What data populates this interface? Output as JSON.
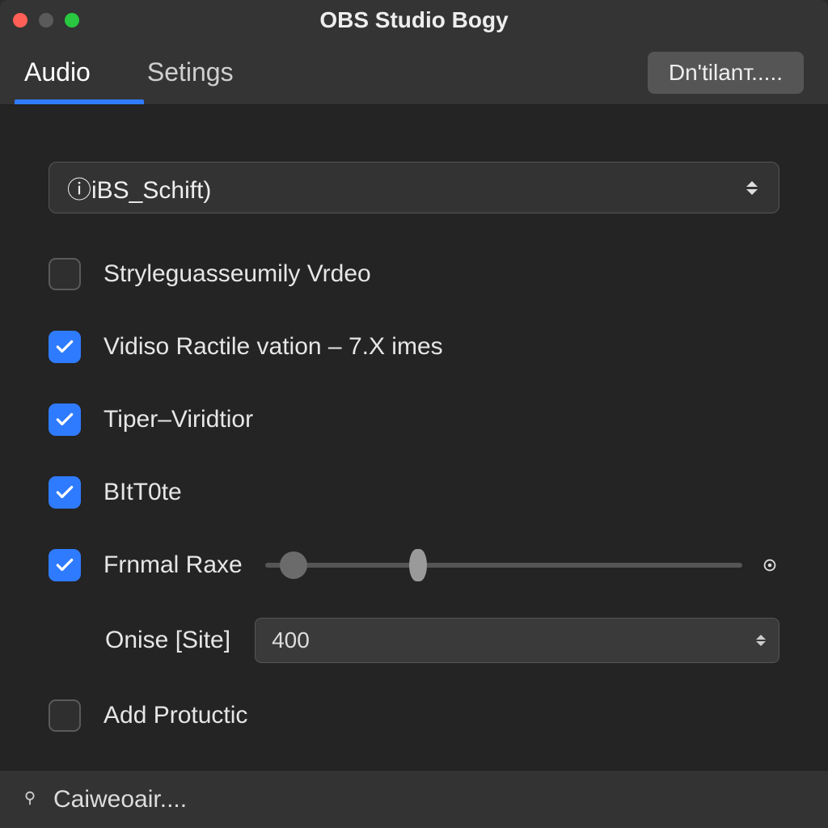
{
  "window": {
    "title": "OBS Studio Bogy"
  },
  "tabs": [
    {
      "label": "Audio",
      "active": true
    },
    {
      "label": "Setings",
      "active": false
    }
  ],
  "header_button_label": "Dn'tilanт.....",
  "profile_select": {
    "value": "ⓘiBS_Schift)"
  },
  "options": [
    {
      "checked": false,
      "label": "Stryleguasseumily Vrdeo"
    },
    {
      "checked": true,
      "label": "Vidiso Ractile vation – 7.X imes"
    },
    {
      "checked": true,
      "label": "Tiper–Viridtior"
    },
    {
      "checked": true,
      "label": "BItT0te"
    },
    {
      "checked": true,
      "label": "Frnmal Raxe",
      "slider": {
        "posA": 6,
        "posB": 32
      }
    }
  ],
  "onise": {
    "label": "Onise [Site]",
    "value": "400"
  },
  "add_protuctic": {
    "checked": false,
    "label": "Add Protuctic"
  },
  "statusbar": {
    "text": "Caiweoair...."
  },
  "colors": {
    "accent": "#2f7bff"
  }
}
